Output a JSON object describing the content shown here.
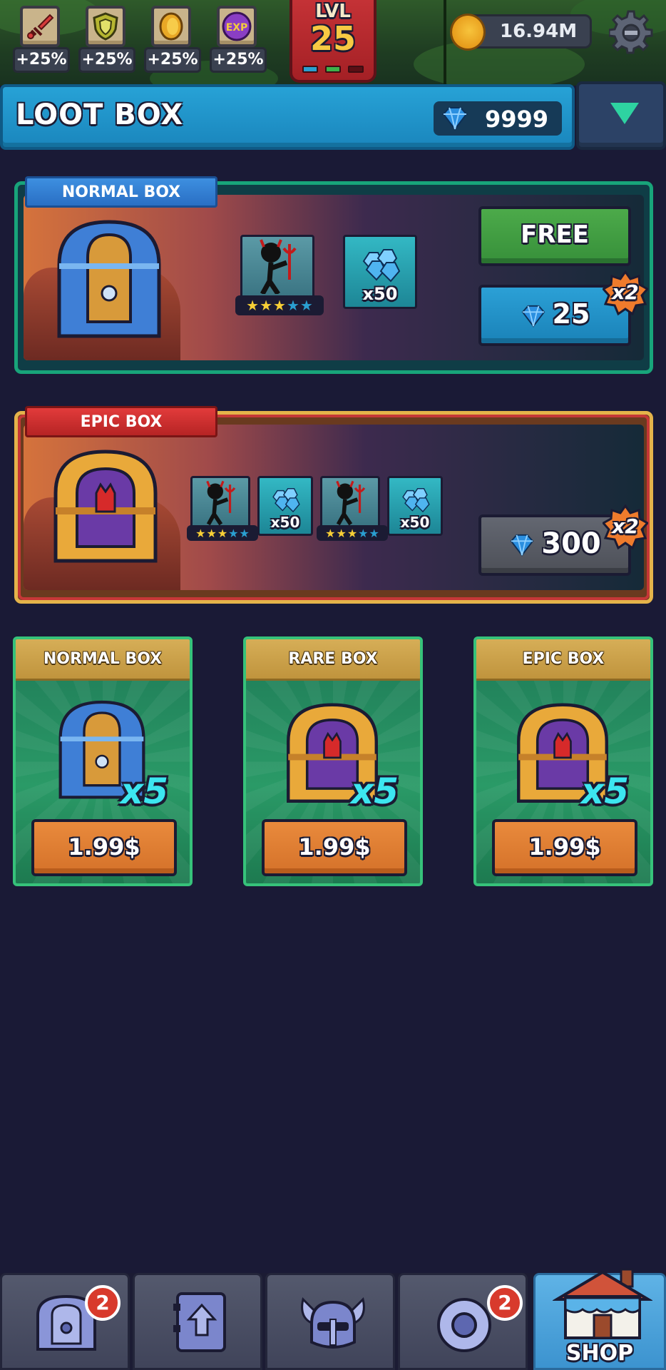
{
  "hud": {
    "buffs": [
      {
        "icon": "sword-icon",
        "value": "+25%"
      },
      {
        "icon": "shield-icon",
        "value": "+25%"
      },
      {
        "icon": "coin-icon",
        "value": "+25%"
      },
      {
        "icon": "exp-icon",
        "value": "+25%",
        "badge": "EXP"
      }
    ],
    "level_label": "LVL",
    "level": "25",
    "coins": "16.94M"
  },
  "title_bar": {
    "title": "LOOT BOX",
    "gems": "9999"
  },
  "featured": {
    "normal": {
      "ribbon": "NORMAL BOX",
      "reward_gems": "x50",
      "free_label": "FREE",
      "price": "25",
      "multiplier": "x2"
    },
    "epic": {
      "ribbon": "EPIC BOX",
      "reward_gems_1": "x50",
      "reward_gems_2": "x50",
      "price": "300",
      "multiplier": "x2"
    }
  },
  "shop_cards": [
    {
      "title": "NORMAL BOX",
      "qty": "x5",
      "price": "1.99$"
    },
    {
      "title": "RARE BOX",
      "qty": "x5",
      "price": "1.99$"
    },
    {
      "title": "EPIC BOX",
      "qty": "x5",
      "price": "1.99$"
    }
  ],
  "nav": {
    "chest_badge": "2",
    "ring_badge": "2",
    "shop_label": "SHOP"
  },
  "colors": {
    "background": "#1a1a36",
    "title_blue": "#1a86bd",
    "free_green": "#37903a",
    "gem_blue": "#2b8fe0",
    "price_orange": "#d5722a",
    "card_header_gold": "#c0943d"
  }
}
